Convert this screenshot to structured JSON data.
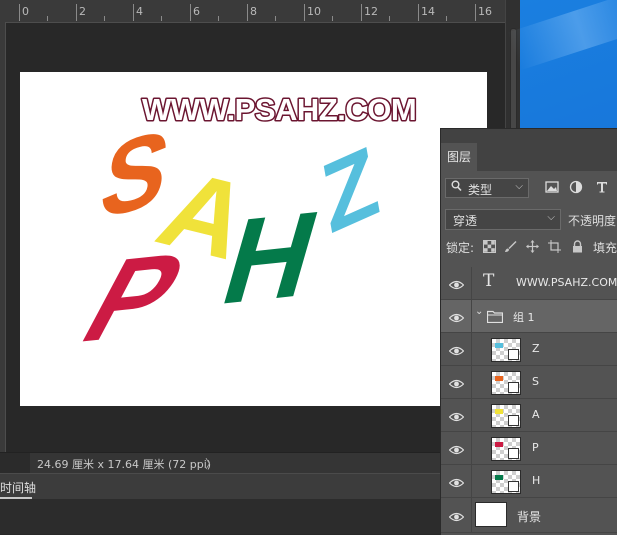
{
  "ruler": {
    "labels": [
      "0",
      "2",
      "4",
      "6",
      "8",
      "10",
      "12",
      "14",
      "16",
      "18",
      "20",
      "22",
      "24"
    ]
  },
  "canvas": {
    "watermark": "WWW.PSAHZ.COM",
    "letters": {
      "s": "S",
      "a": "A",
      "h": "H",
      "z": "Z",
      "p": "P"
    },
    "colors": {
      "s": "#e8641e",
      "a": "#f0e23a",
      "h": "#047a4a",
      "z": "#56bfdd",
      "p": "#cc1b44",
      "watermark_fill": "#ffffff",
      "watermark_stroke": "#6b1530"
    }
  },
  "status": {
    "doc_info": "24.69 厘米 x 17.64 厘米 (72 ppi)",
    "arrow": "〉"
  },
  "timeline": {
    "tab_label": "时间轴"
  },
  "layers_panel": {
    "tab_label": "图层",
    "filter": {
      "icon": "search-icon",
      "label": "类型",
      "chevron": "⌵"
    },
    "blend_mode": "穿透",
    "blend_chevron": "⌵",
    "opacity_label": "不透明度",
    "lock_label": "锁定:",
    "fill_label": "填充",
    "layers": [
      {
        "name": "WWW.PSAHZ.COM",
        "kind": "text",
        "icon_glyph": "T"
      },
      {
        "name": "组 1",
        "kind": "group",
        "expand_glyph": "⌄",
        "selected": true
      },
      {
        "name": "Z",
        "kind": "smart",
        "mark_color": "#56bfdd"
      },
      {
        "name": "S",
        "kind": "smart",
        "mark_color": "#e8641e"
      },
      {
        "name": "A",
        "kind": "smart",
        "mark_color": "#f0e23a"
      },
      {
        "name": "P",
        "kind": "smart",
        "mark_color": "#cc1b44"
      },
      {
        "name": "H",
        "kind": "smart",
        "mark_color": "#047a4a"
      },
      {
        "name": "背景",
        "kind": "background"
      }
    ]
  }
}
